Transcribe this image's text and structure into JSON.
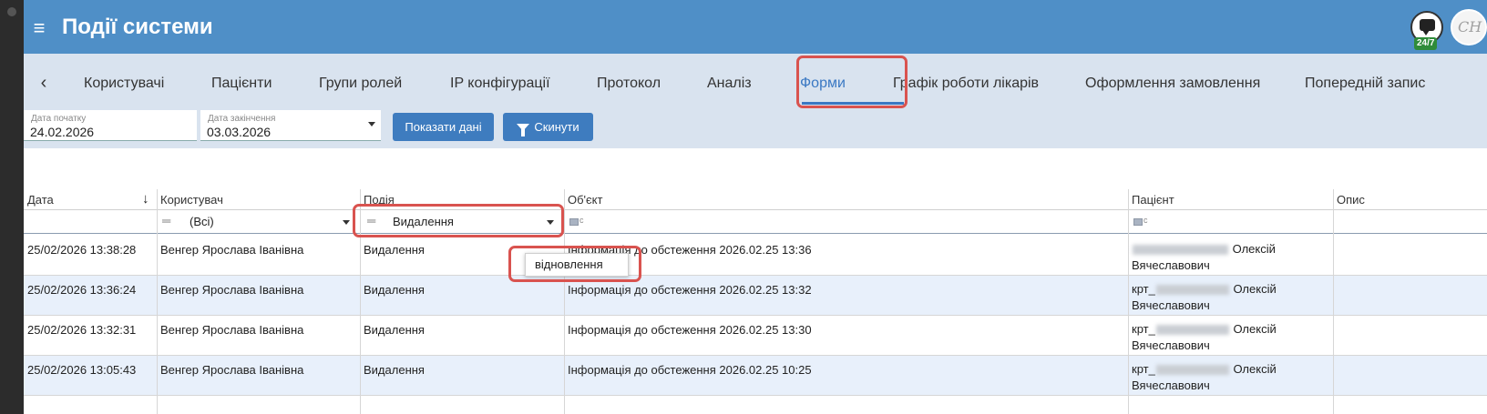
{
  "header": {
    "title": "Події системи",
    "menu_icon": "hamburger-icon",
    "chat_badge": "24/7",
    "accent_color": "#4f8fc7"
  },
  "tabs": [
    {
      "label": "Користувачі"
    },
    {
      "label": "Пацієнти"
    },
    {
      "label": "Групи ролей"
    },
    {
      "label": "IP конфігурації"
    },
    {
      "label": "Протокол"
    },
    {
      "label": "Аналіз"
    },
    {
      "label": "Форми",
      "active": true
    },
    {
      "label": "Графік роботи лікарів"
    },
    {
      "label": "Оформлення замовлення"
    },
    {
      "label": "Попередній запис"
    }
  ],
  "filters": {
    "start_label": "Дата початку",
    "start_value": "24.02.2026",
    "end_label": "Дата закінчення",
    "end_value": "03.03.2026",
    "show_button": "Показати дані",
    "reset_button": "Скинути"
  },
  "grid": {
    "columns": [
      "Дата",
      "Користувач",
      "Подія",
      "Об'єкт",
      "Пацієнт",
      "Опис"
    ],
    "filter_user": "(Всі)",
    "filter_event": "Видалення",
    "filter_icon_suffix": "c",
    "rows": [
      {
        "date": "25/02/2026 13:38:28",
        "user": "Венгер Ярослава Іванівна",
        "event": "Видалення",
        "object": "Інформація до обстеження 2026.02.25 13:36",
        "patient_prefix": "",
        "patient_name": "Олексій",
        "patient_patronymic": "Вячеславович"
      },
      {
        "date": "25/02/2026 13:36:24",
        "user": "Венгер Ярослава Іванівна",
        "event": "Видалення",
        "object": "Інформація до обстеження 2026.02.25 13:32",
        "patient_prefix": "крт_",
        "patient_name": "Олексій",
        "patient_patronymic": "Вячеславович"
      },
      {
        "date": "25/02/2026 13:32:31",
        "user": "Венгер Ярослава Іванівна",
        "event": "Видалення",
        "object": "Інформація до обстеження 2026.02.25 13:30",
        "patient_prefix": "крт_",
        "patient_name": "Олексій",
        "patient_patronymic": "Вячеславович"
      },
      {
        "date": "25/02/2026 13:05:43",
        "user": "Венгер Ярослава Іванівна",
        "event": "Видалення",
        "object": "Інформація до обстеження 2026.02.25 10:25",
        "patient_prefix": "крт_",
        "patient_name": "Олексій",
        "patient_patronymic": "Вячеславович"
      }
    ]
  },
  "dropdown_option": "відновлення",
  "highlight_color": "#d9534f"
}
